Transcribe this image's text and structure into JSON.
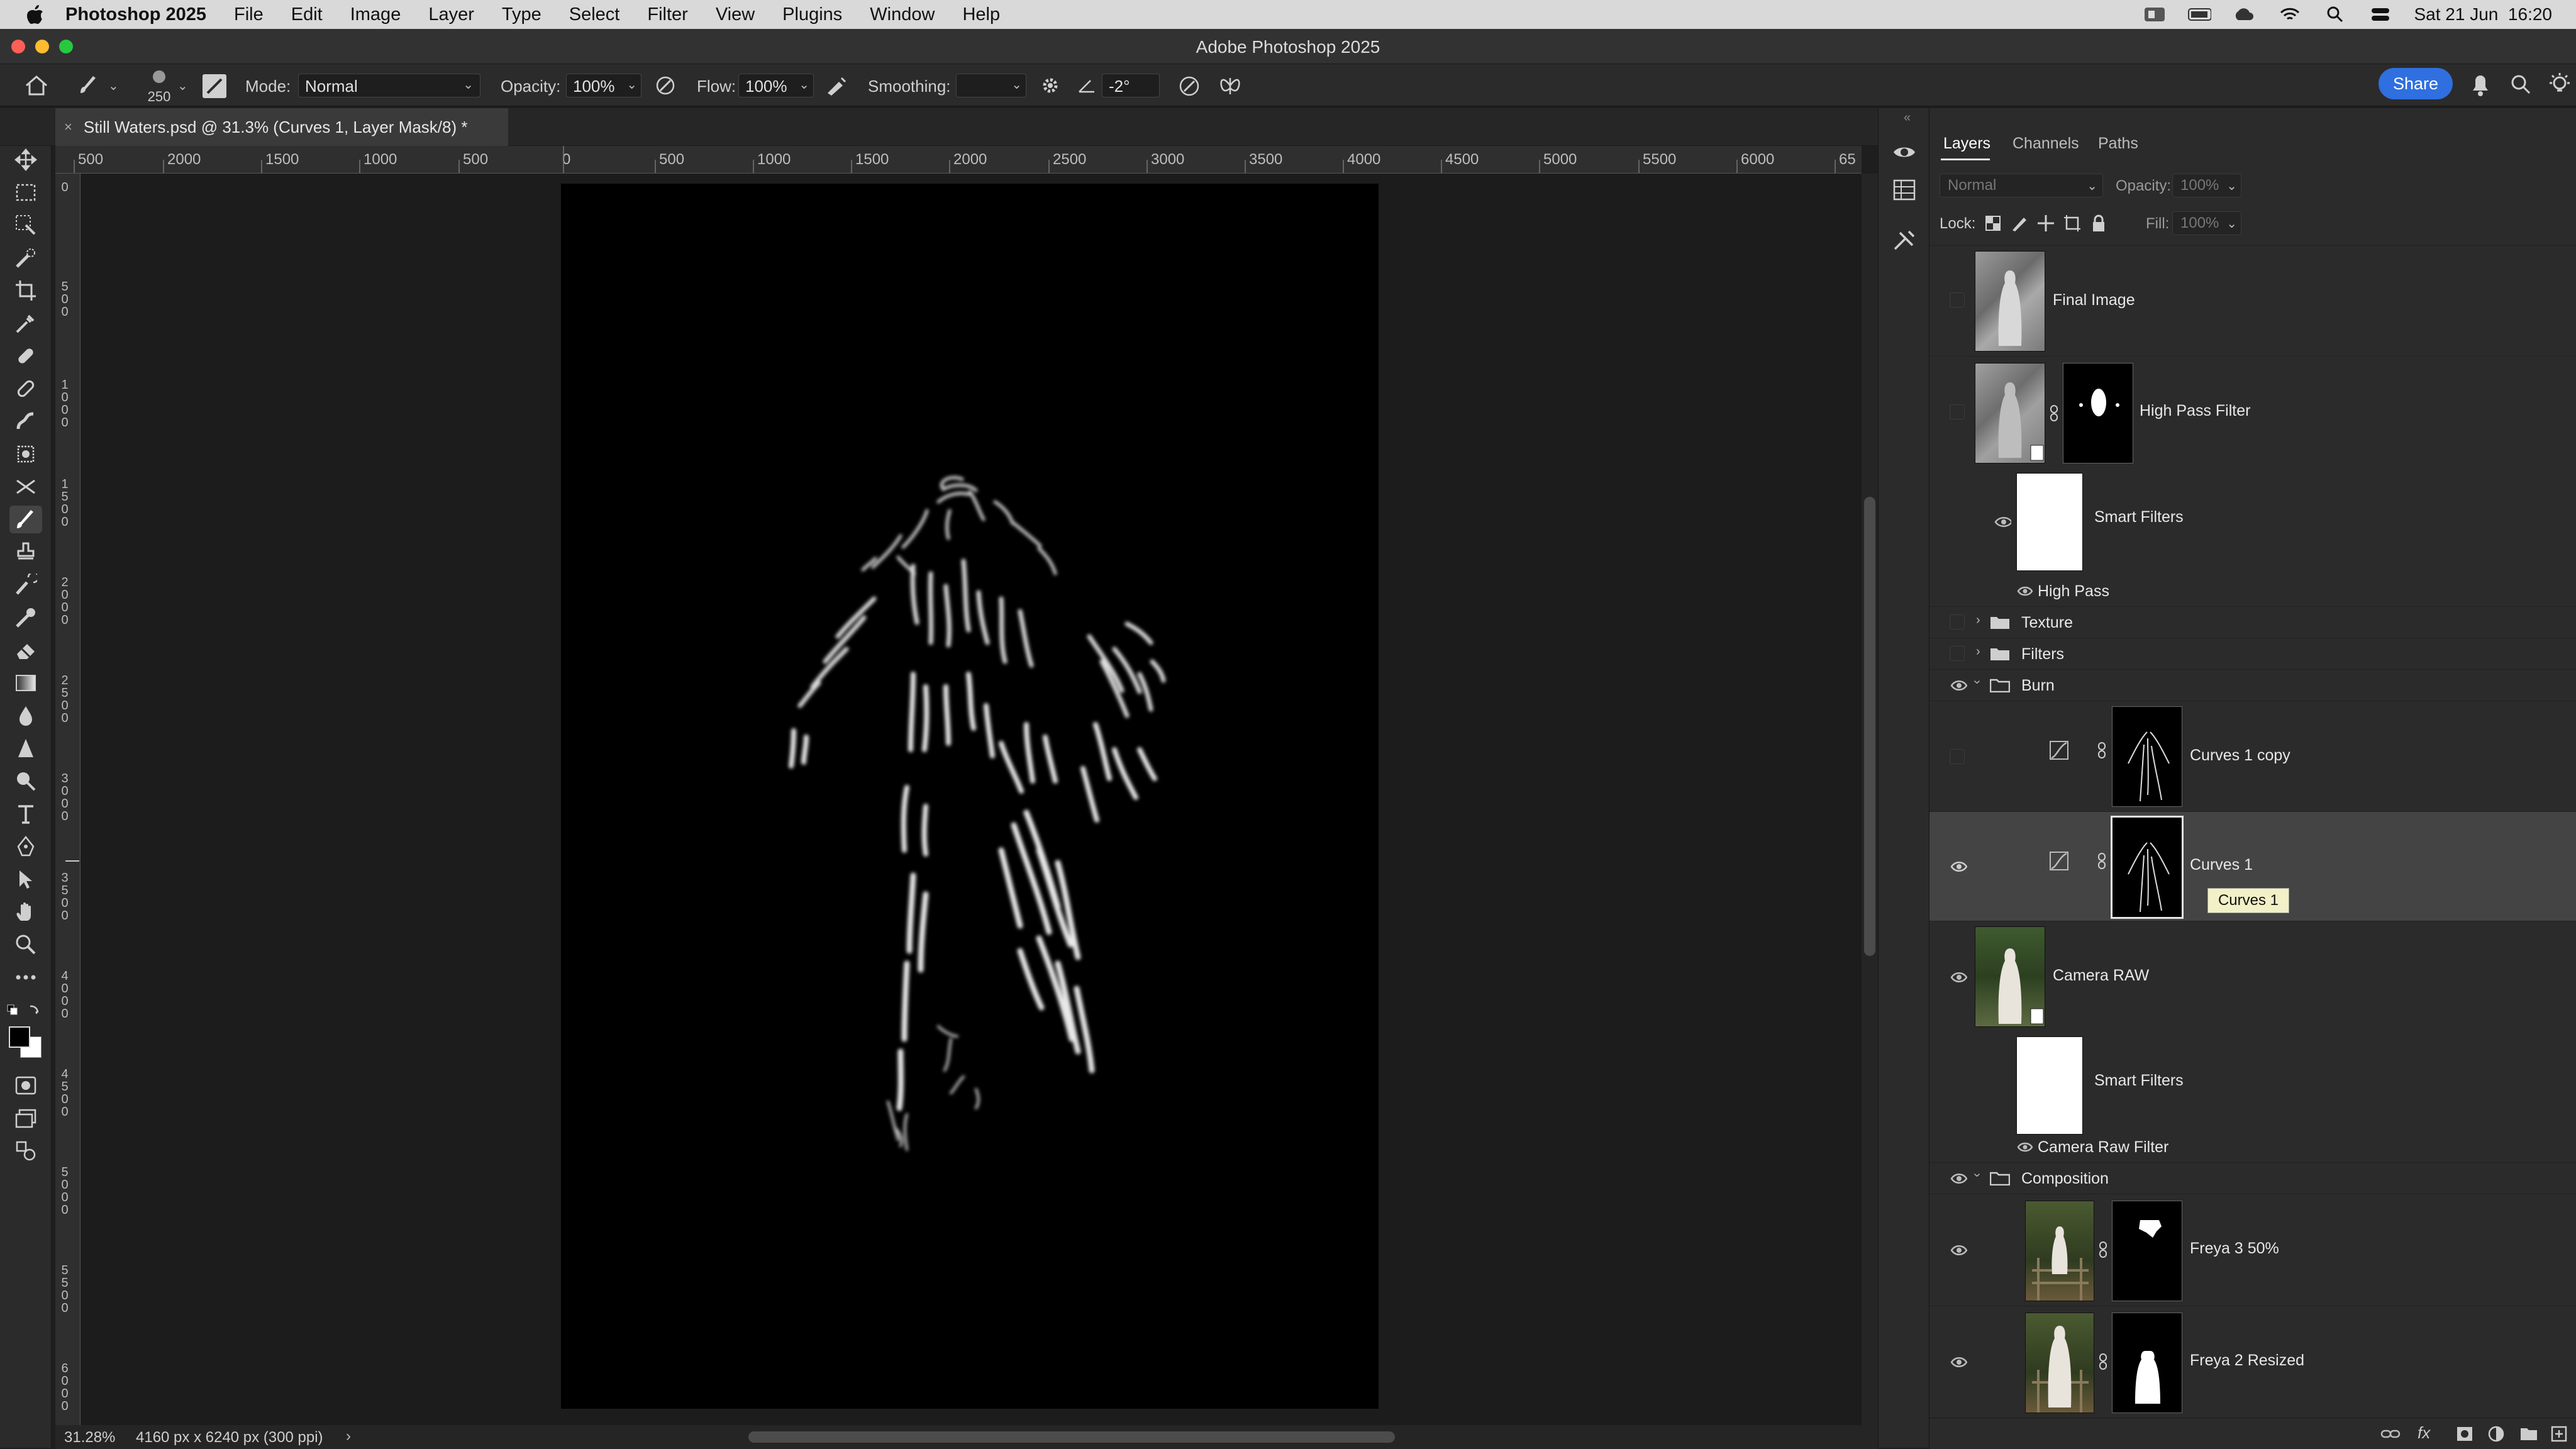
{
  "menubar": {
    "app_name": "Photoshop 2025",
    "items": [
      "File",
      "Edit",
      "Image",
      "Layer",
      "Type",
      "Select",
      "Filter",
      "View",
      "Plugins",
      "Window",
      "Help"
    ],
    "clock": "Sat 21 Jun  16:20"
  },
  "window": {
    "title": "Adobe Photoshop 2025"
  },
  "options": {
    "brush_size": "250",
    "mode_label": "Mode:",
    "mode_value": "Normal",
    "opacity_label": "Opacity:",
    "opacity_value": "100%",
    "flow_label": "Flow:",
    "flow_value": "100%",
    "smoothing_label": "Smoothing:",
    "smoothing_value": "",
    "angle_value": "-2°",
    "share_label": "Share"
  },
  "document": {
    "tab_title": "Still Waters.psd @ 31.3% (Curves 1, Layer Mask/8) *",
    "zoom": "31.28%",
    "info": "4160 px x 6240 px (300 ppi)"
  },
  "rulers": {
    "h_labels": [
      "500",
      "2000",
      "1500",
      "1000",
      "500",
      "0",
      "500",
      "1000",
      "1500",
      "2000",
      "2500",
      "3000",
      "3500",
      "4000",
      "4500",
      "5000",
      "5500",
      "6000",
      "65"
    ],
    "v_labels": [
      "0",
      "500",
      "1000",
      "1500",
      "2000",
      "2500",
      "3000",
      "3500",
      "4000",
      "4500",
      "5000",
      "5500",
      "6000"
    ]
  },
  "panel": {
    "tabs": [
      "Layers",
      "Channels",
      "Paths"
    ],
    "blend_mode": "Normal",
    "opacity_label": "Opacity:",
    "opacity_value": "100%",
    "lock_label": "Lock:",
    "fill_label": "Fill:",
    "fill_value": "100%",
    "tooltip": "Curves 1",
    "layers": [
      {
        "name": "Final Image",
        "visible": false
      },
      {
        "name": "High Pass Filter",
        "visible": false
      },
      {
        "name": "Smart Filters",
        "visible": true
      },
      {
        "name": "High Pass",
        "visible": true
      },
      {
        "name": "Texture",
        "visible": false
      },
      {
        "name": "Filters",
        "visible": false
      },
      {
        "name": "Burn",
        "visible": true
      },
      {
        "name": "Curves 1 copy",
        "visible": false
      },
      {
        "name": "Curves 1",
        "visible": true,
        "selected": true
      },
      {
        "name": "Camera RAW",
        "visible": true
      },
      {
        "name": "Smart Filters",
        "visible": true
      },
      {
        "name": "Camera Raw Filter",
        "visible": true
      },
      {
        "name": "Composition",
        "visible": true
      },
      {
        "name": "Freya 3 50%",
        "visible": true
      },
      {
        "name": "Freya 2 Resized",
        "visible": true
      }
    ]
  },
  "colors": {
    "accent": "#2f6fe0",
    "selection": "#444444",
    "canvas": "#000000"
  }
}
